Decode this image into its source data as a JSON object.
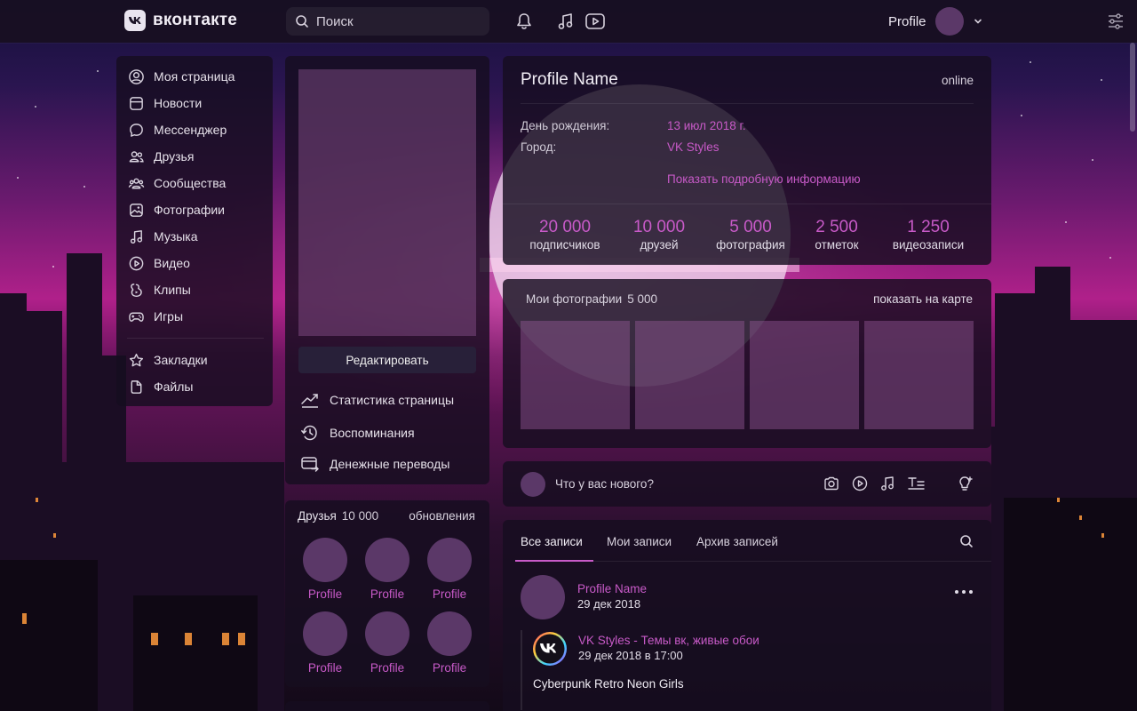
{
  "colors": {
    "accent": "#c85ac8",
    "topbar": "#181022",
    "panel": "#160e20",
    "placeholder_photo": "#945896",
    "avatar": "#5b3868"
  },
  "header": {
    "logo_text": "вконтакте",
    "search_placeholder": "Поиск",
    "icons": [
      "bell-icon",
      "music-icon",
      "video-icon"
    ],
    "profile_label": "Profile",
    "settings_icon": "sliders-icon"
  },
  "sidebar": {
    "items": [
      {
        "label": "Моя страница",
        "icon": "user-circle-icon"
      },
      {
        "label": "Новости",
        "icon": "news-icon"
      },
      {
        "label": "Мессенджер",
        "icon": "message-icon"
      },
      {
        "label": "Друзья",
        "icon": "friends-icon"
      },
      {
        "label": "Сообщества",
        "icon": "communities-icon"
      },
      {
        "label": "Фотографии",
        "icon": "photo-icon"
      },
      {
        "label": "Музыка",
        "icon": "music-icon"
      },
      {
        "label": "Видео",
        "icon": "play-icon"
      },
      {
        "label": "Клипы",
        "icon": "clips-icon"
      },
      {
        "label": "Игры",
        "icon": "gamepad-icon"
      }
    ],
    "extra_items": [
      {
        "label": "Закладки",
        "icon": "star-icon"
      },
      {
        "label": "Файлы",
        "icon": "file-icon"
      }
    ]
  },
  "profile_column": {
    "edit_button": "Редактировать",
    "links": [
      {
        "label": "Статистика страницы",
        "icon": "chart-icon"
      },
      {
        "label": "Воспоминания",
        "icon": "history-icon"
      },
      {
        "label": "Денежные переводы",
        "icon": "transfer-icon"
      }
    ]
  },
  "friends": {
    "title": "Друзья",
    "count": "10 000",
    "updates_label": "обновления",
    "names": [
      "Profile",
      "Profile",
      "Profile",
      "Profile",
      "Profile",
      "Profile"
    ]
  },
  "info": {
    "name": "Profile Name",
    "status": "online",
    "birthday_label": "День рождения:",
    "birthday_value": "13 июл 2018 г.",
    "city_label": "Город:",
    "city_value": "VK Styles",
    "more_link": "Показать подробную информацию",
    "stats": [
      {
        "num": "20 000",
        "label": "подписчиков"
      },
      {
        "num": "10 000",
        "label": "друзей"
      },
      {
        "num": "5 000",
        "label": "фотография"
      },
      {
        "num": "2 500",
        "label": "отметок"
      },
      {
        "num": "1 250",
        "label": "видеозаписи"
      }
    ]
  },
  "photos": {
    "title": "Мои фотографии",
    "count": "5 000",
    "map_link": "показать на карте"
  },
  "compose": {
    "placeholder": "Что у вас нового?",
    "icons": [
      "camera-icon",
      "video-icon",
      "music-icon",
      "text-icon",
      "lightbulb-icon"
    ]
  },
  "wall": {
    "tabs": [
      "Все записи",
      "Мои записи",
      "Архив записей"
    ],
    "post": {
      "author": "Profile Name",
      "date": "29 дек 2018",
      "repost_author": "VK Styles - Темы вк, живые обои",
      "repost_date": "29 дек 2018 в 17:00",
      "text": "Cyberpunk Retro Neon Girls"
    }
  }
}
